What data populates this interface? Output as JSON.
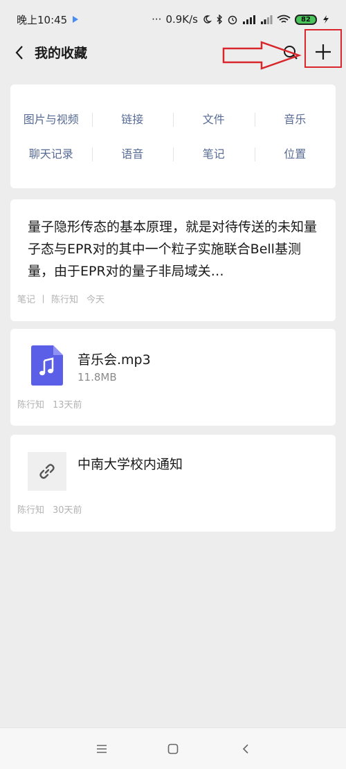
{
  "status_bar": {
    "time": "晚上10:45",
    "network_speed": "0.9K/s",
    "battery": "82"
  },
  "header": {
    "title": "我的收藏"
  },
  "categories": [
    [
      "图片与视频",
      "链接",
      "文件",
      "音乐"
    ],
    [
      "聊天记录",
      "语音",
      "笔记",
      "位置"
    ]
  ],
  "items": {
    "note": {
      "text": "量子隐形传态的基本原理，就是对待传送的未知量子态与EPR对的其中一个粒子实施联合Bell基测量，由于EPR对的量子非局域关…",
      "type_label": "笔记",
      "author": "陈行知",
      "time": "今天"
    },
    "file": {
      "name": "音乐会.mp3",
      "size": "11.8MB",
      "author": "陈行知",
      "time": "13天前",
      "icon": "music-file-icon",
      "icon_color": "#5b5fe8"
    },
    "link": {
      "title": "中南大学校内通知",
      "author": "陈行知",
      "time": "30天前",
      "icon": "link-icon"
    }
  },
  "colors": {
    "category_text": "#576b95",
    "highlight": "#d8262c"
  }
}
